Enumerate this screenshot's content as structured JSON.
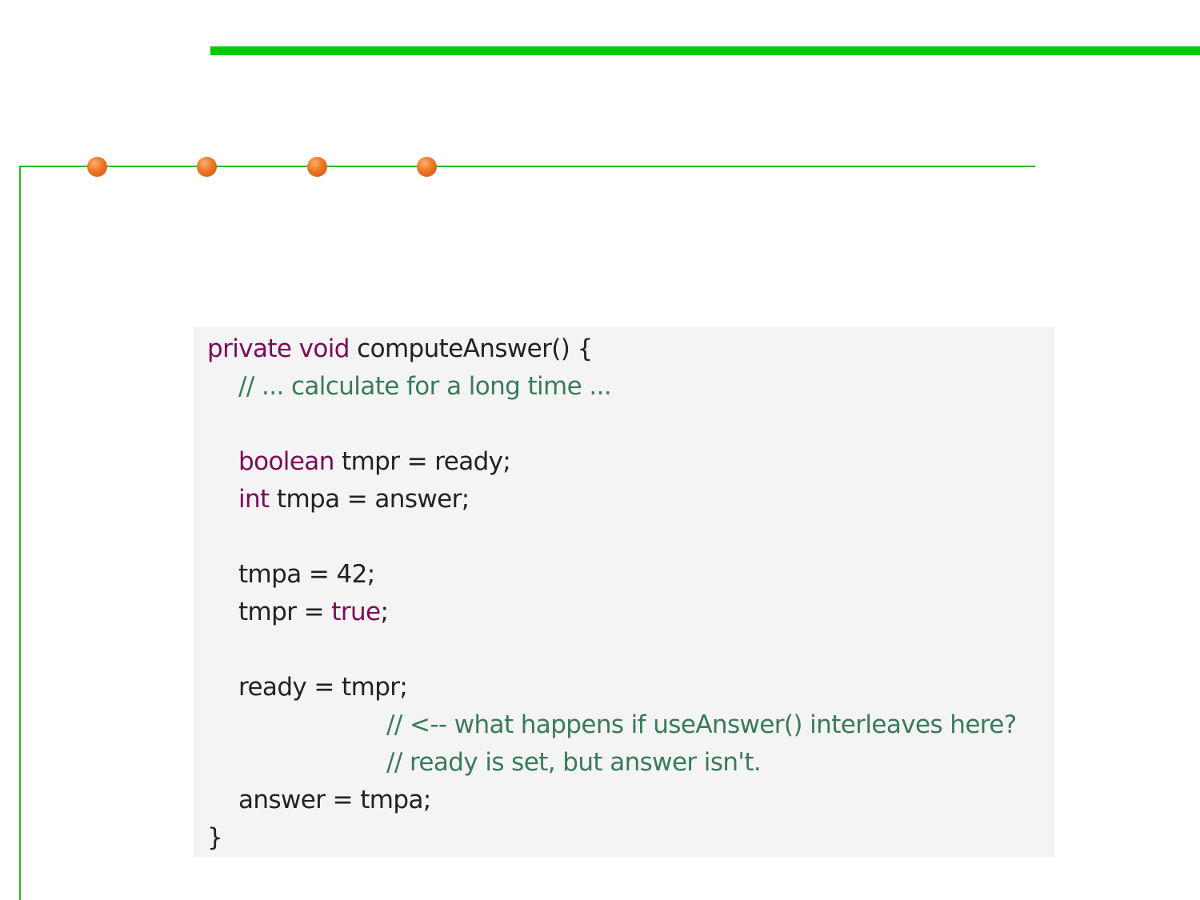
{
  "decor": {
    "top_bar_color": "#00cc00",
    "rule_color": "#22bb22",
    "bullet_color": "#f07a28",
    "bullet_count": 4
  },
  "code": {
    "lines": {
      "l1_kw1": "private",
      "l1_kw2": "void",
      "l1_rest": "computeAnswer() {",
      "l2_comment": "// ... calculate for a long time ...",
      "l4_kw": "boolean",
      "l4_rest": "tmpr = ready;",
      "l5_kw": "int",
      "l5_rest": "tmpa = answer;",
      "l7": "tmpa = 42;",
      "l8_pre": "tmpr = ",
      "l8_kw": "true",
      "l8_post": ";",
      "l10": "ready = tmpr;",
      "l11_comment": "// <-- what happens if useAnswer() interleaves here?",
      "l12_comment": "// ready is set, but answer isn't.",
      "l13": "answer = tmpa;",
      "l14": "}"
    },
    "colors": {
      "background": "#f4f4f4",
      "keyword": "#7a0a5a",
      "comment": "#3a7a5a",
      "text": "#222222"
    }
  }
}
